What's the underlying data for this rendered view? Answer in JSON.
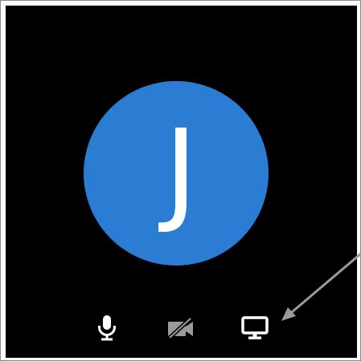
{
  "participant": {
    "initial": "J",
    "avatar_color": "#2b7cd3"
  },
  "controls": [
    {
      "icon": "microphone-icon",
      "state": "on"
    },
    {
      "icon": "video-off-icon",
      "state": "off"
    },
    {
      "icon": "screen-share-icon",
      "state": "on"
    }
  ],
  "colors": {
    "tile_background": "#000000",
    "icon_color": "#ffffff",
    "annotation_arrow": "#9a9a9a"
  }
}
